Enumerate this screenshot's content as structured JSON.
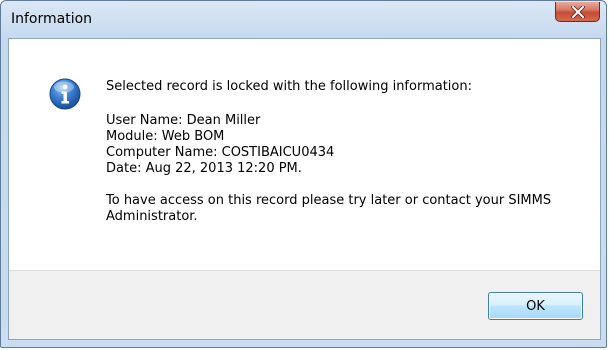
{
  "window": {
    "title": "Information"
  },
  "dialog": {
    "icon": "info-icon",
    "message_intro": "Selected record is locked with the following information:",
    "details": [
      "User Name: Dean Miller",
      "Module: Web BOM",
      "Computer Name: COSTIBAICU0434",
      "Date: Aug 22, 2013 12:20 PM."
    ],
    "message_footer": "To have access on this record please try later or contact your SIMMS Administrator."
  },
  "buttons": {
    "ok_label": "OK"
  },
  "colors": {
    "close_button": "#c44c34",
    "info_icon": "#1f5fb0",
    "footer_bg": "#f0f0f0"
  }
}
